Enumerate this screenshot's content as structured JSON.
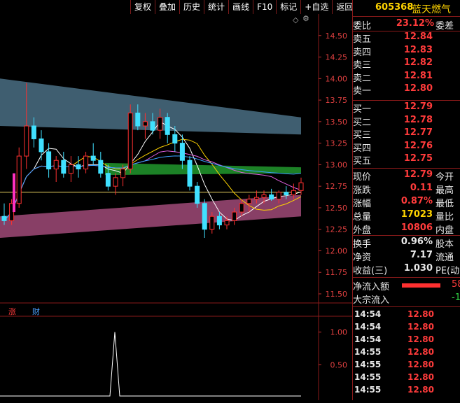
{
  "toolbar": {
    "buttons": [
      "复权",
      "叠加",
      "历史",
      "统计",
      "画线",
      "F10",
      "标记",
      "+自选",
      "返回"
    ]
  },
  "stock": {
    "code": "605368",
    "name": "蓝天燃气"
  },
  "orderbook": {
    "ratio_label": "委比",
    "ratio_value": "23.12%",
    "diff_label": "委差",
    "asks": [
      {
        "label": "卖五",
        "price": "12.84"
      },
      {
        "label": "卖四",
        "price": "12.83"
      },
      {
        "label": "卖三",
        "price": "12.82"
      },
      {
        "label": "卖二",
        "price": "12.81"
      },
      {
        "label": "卖一",
        "price": "12.80"
      }
    ],
    "bids": [
      {
        "label": "买一",
        "price": "12.79"
      },
      {
        "label": "买二",
        "price": "12.78"
      },
      {
        "label": "买三",
        "price": "12.77"
      },
      {
        "label": "买四",
        "price": "12.76"
      },
      {
        "label": "买五",
        "price": "12.75"
      }
    ]
  },
  "quote": {
    "rows": [
      {
        "label": "现价",
        "value": "12.79",
        "label2": "今开"
      },
      {
        "label": "涨跌",
        "value": "0.11",
        "label2": "最高"
      },
      {
        "label": "涨幅",
        "value": "0.87%",
        "label2": "最低"
      },
      {
        "label": "总量",
        "value": "17023",
        "label2": "量比"
      },
      {
        "label": "外盘",
        "value": "10806",
        "label2": "内盘"
      }
    ],
    "rows2": [
      {
        "label": "换手",
        "value": "0.96%",
        "label2": "股本"
      },
      {
        "label": "净资",
        "value": "7.17",
        "label2": "流通"
      },
      {
        "label": "收益(三)",
        "value": "1.030",
        "label2": "PE(动"
      }
    ]
  },
  "flow": {
    "net_inflow_label": "净流入额",
    "net_inflow_value": "58",
    "block_inflow_label": "大宗流入",
    "block_inflow_value": "-1"
  },
  "trades": [
    {
      "time": "14:54",
      "price": "12.80"
    },
    {
      "time": "14:54",
      "price": "12.80"
    },
    {
      "time": "14:54",
      "price": "12.80"
    },
    {
      "time": "14:55",
      "price": "12.80"
    },
    {
      "time": "14:55",
      "price": "12.80"
    },
    {
      "time": "14:55",
      "price": "12.80"
    },
    {
      "time": "14:55",
      "price": "12.80"
    }
  ],
  "chart_data": {
    "type": "candlestick",
    "y_ticks": [
      "14.50",
      "14.25",
      "14.00",
      "13.75",
      "13.50",
      "13.25",
      "13.00",
      "12.75",
      "12.50",
      "12.25",
      "12.00",
      "11.75",
      "11.50"
    ],
    "y_range": [
      11.5,
      14.75
    ],
    "reference_price": 12.68,
    "candles": [
      {
        "o": 12.4,
        "h": 12.55,
        "l": 12.3,
        "c": 12.35
      },
      {
        "o": 12.35,
        "h": 12.6,
        "l": 12.3,
        "c": 12.55
      },
      {
        "o": 12.55,
        "h": 13.2,
        "l": 12.5,
        "c": 13.1
      },
      {
        "o": 13.1,
        "h": 13.95,
        "l": 12.95,
        "c": 13.45
      },
      {
        "o": 13.45,
        "h": 13.55,
        "l": 13.2,
        "c": 13.3
      },
      {
        "o": 13.3,
        "h": 13.4,
        "l": 13.05,
        "c": 13.15
      },
      {
        "o": 13.15,
        "h": 13.25,
        "l": 12.85,
        "c": 12.95
      },
      {
        "o": 12.95,
        "h": 13.1,
        "l": 12.8,
        "c": 13.05
      },
      {
        "o": 13.05,
        "h": 13.15,
        "l": 12.85,
        "c": 12.9
      },
      {
        "o": 12.9,
        "h": 13.1,
        "l": 12.8,
        "c": 13.0
      },
      {
        "o": 13.0,
        "h": 13.1,
        "l": 12.85,
        "c": 12.95
      },
      {
        "o": 12.95,
        "h": 13.15,
        "l": 12.9,
        "c": 13.1
      },
      {
        "o": 13.1,
        "h": 13.25,
        "l": 13.0,
        "c": 13.05
      },
      {
        "o": 13.05,
        "h": 13.15,
        "l": 12.85,
        "c": 12.9
      },
      {
        "o": 12.9,
        "h": 13.0,
        "l": 12.7,
        "c": 12.75
      },
      {
        "o": 12.75,
        "h": 12.9,
        "l": 12.65,
        "c": 12.85
      },
      {
        "o": 12.85,
        "h": 13.0,
        "l": 12.75,
        "c": 12.95
      },
      {
        "o": 12.95,
        "h": 13.7,
        "l": 12.9,
        "c": 13.6
      },
      {
        "o": 13.6,
        "h": 13.7,
        "l": 13.4,
        "c": 13.45
      },
      {
        "o": 13.45,
        "h": 13.6,
        "l": 13.3,
        "c": 13.5
      },
      {
        "o": 13.5,
        "h": 13.6,
        "l": 13.35,
        "c": 13.4
      },
      {
        "o": 13.4,
        "h": 13.65,
        "l": 13.3,
        "c": 13.55
      },
      {
        "o": 13.55,
        "h": 13.6,
        "l": 13.25,
        "c": 13.35
      },
      {
        "o": 13.35,
        "h": 13.45,
        "l": 13.15,
        "c": 13.25
      },
      {
        "o": 13.25,
        "h": 13.35,
        "l": 12.95,
        "c": 13.05
      },
      {
        "o": 13.05,
        "h": 13.1,
        "l": 12.7,
        "c": 12.75
      },
      {
        "o": 12.75,
        "h": 12.8,
        "l": 12.5,
        "c": 12.55
      },
      {
        "o": 12.55,
        "h": 12.6,
        "l": 12.15,
        "c": 12.25
      },
      {
        "o": 12.25,
        "h": 12.45,
        "l": 12.2,
        "c": 12.4
      },
      {
        "o": 12.4,
        "h": 12.45,
        "l": 12.25,
        "c": 12.3
      },
      {
        "o": 12.3,
        "h": 12.4,
        "l": 12.25,
        "c": 12.35
      },
      {
        "o": 12.35,
        "h": 12.5,
        "l": 12.3,
        "c": 12.45
      },
      {
        "o": 12.45,
        "h": 12.6,
        "l": 12.4,
        "c": 12.55
      },
      {
        "o": 12.55,
        "h": 12.65,
        "l": 12.45,
        "c": 12.6
      },
      {
        "o": 12.6,
        "h": 12.7,
        "l": 12.55,
        "c": 12.62
      },
      {
        "o": 12.62,
        "h": 12.7,
        "l": 12.55,
        "c": 12.65
      },
      {
        "o": 12.65,
        "h": 12.72,
        "l": 12.58,
        "c": 12.6
      },
      {
        "o": 12.6,
        "h": 12.7,
        "l": 12.55,
        "c": 12.68
      },
      {
        "o": 12.68,
        "h": 12.75,
        "l": 12.6,
        "c": 12.65
      },
      {
        "o": 12.65,
        "h": 12.78,
        "l": 12.6,
        "c": 12.7
      },
      {
        "o": 12.7,
        "h": 12.85,
        "l": 12.65,
        "c": 12.79
      }
    ],
    "upper_band": {
      "top_start": 14.0,
      "top_end": 13.55,
      "bot_start": 13.45,
      "bot_end": 13.35
    },
    "lower_band": {
      "top_start": 12.4,
      "top_end": 12.65,
      "bot_start": 12.15,
      "bot_end": 12.4
    },
    "indicator": {
      "y_ticks": [
        "1.00",
        "0.50"
      ],
      "spike_value": 1.0
    },
    "markers": [
      "涨",
      "财"
    ]
  }
}
